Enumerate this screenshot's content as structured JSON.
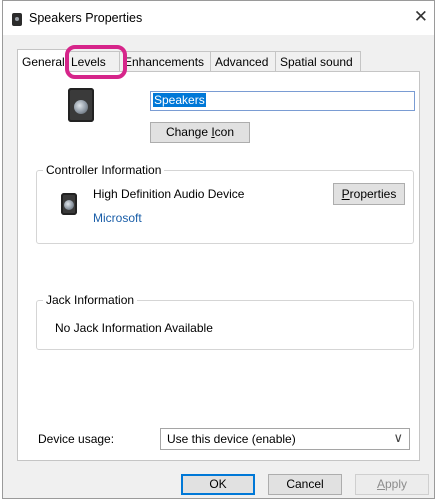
{
  "window": {
    "title": "Speakers Properties",
    "close_glyph": "✕"
  },
  "tabs": [
    {
      "label": "General"
    },
    {
      "label": "Levels"
    },
    {
      "label": "Enhancements"
    },
    {
      "label": "Advanced"
    },
    {
      "label": "Spatial sound"
    }
  ],
  "device": {
    "name": "Speakers",
    "change_icon": {
      "pre": "Change ",
      "accel": "I",
      "post": "con"
    }
  },
  "controller": {
    "section": "Controller Information",
    "name": "High Definition Audio Device",
    "vendor": "Microsoft",
    "properties": {
      "accel": "P",
      "post": "roperties"
    }
  },
  "jack": {
    "section": "Jack Information",
    "text": "No Jack Information Available"
  },
  "usage": {
    "label": "Device usage:",
    "value": "Use this device (enable)",
    "chevron": "∨"
  },
  "buttons": {
    "ok": "OK",
    "cancel": "Cancel",
    "apply": {
      "accel": "A",
      "post": "pply"
    }
  },
  "colors": {
    "highlight": "#d6258a",
    "accent": "#0078d7",
    "link": "#1a5ea8"
  },
  "icons": [
    "speaker-icon",
    "close-icon",
    "chevron-down-icon"
  ]
}
